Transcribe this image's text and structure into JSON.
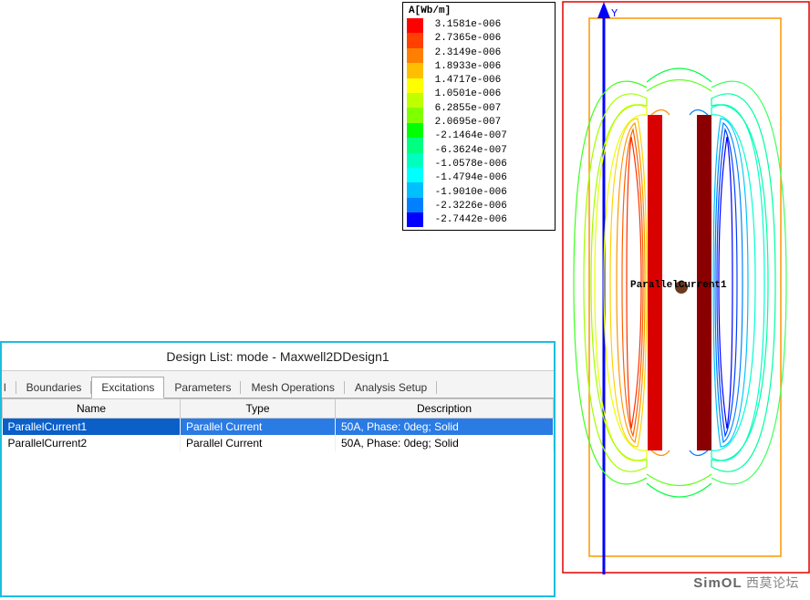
{
  "legend": {
    "title": "A[Wb/m]",
    "values": [
      "3.1581e-006",
      "2.7365e-006",
      "2.3149e-006",
      "1.8933e-006",
      "1.4717e-006",
      "1.0501e-006",
      "6.2855e-007",
      "2.0695e-007",
      "-2.1464e-007",
      "-6.3624e-007",
      "-1.0578e-006",
      "-1.4794e-006",
      "-1.9010e-006",
      "-2.3226e-006",
      "-2.7442e-006"
    ],
    "colors": [
      "#ff0000",
      "#ff4000",
      "#ff8000",
      "#ffbf00",
      "#ffff00",
      "#bfff00",
      "#80ff00",
      "#00ff00",
      "#00ff80",
      "#00ffbf",
      "#00ffff",
      "#00bfff",
      "#0080ff",
      "#0000ff"
    ]
  },
  "plot": {
    "label": "ParallelCurrent1",
    "y_axis_label": "Y",
    "conductor_color_left": "#d90000",
    "conductor_color_right": "#8a0000"
  },
  "design_list": {
    "title": "Design List: mode - Maxwell2DDesign1",
    "tabs": [
      "l",
      "Boundaries",
      "Excitations",
      "Parameters",
      "Mesh Operations",
      "Analysis Setup"
    ],
    "active_tab_index": 2,
    "columns": [
      "Name",
      "Type",
      "Description"
    ],
    "rows": [
      {
        "name": "ParallelCurrent1",
        "type": "Parallel Current",
        "description": "50A, Phase: 0deg; Solid",
        "selected": true
      },
      {
        "name": "ParallelCurrent2",
        "type": "Parallel Current",
        "description": "50A, Phase: 0deg; Solid",
        "selected": false
      }
    ]
  },
  "watermark": {
    "brand": "SimOL",
    "tail": "西莫论坛"
  }
}
